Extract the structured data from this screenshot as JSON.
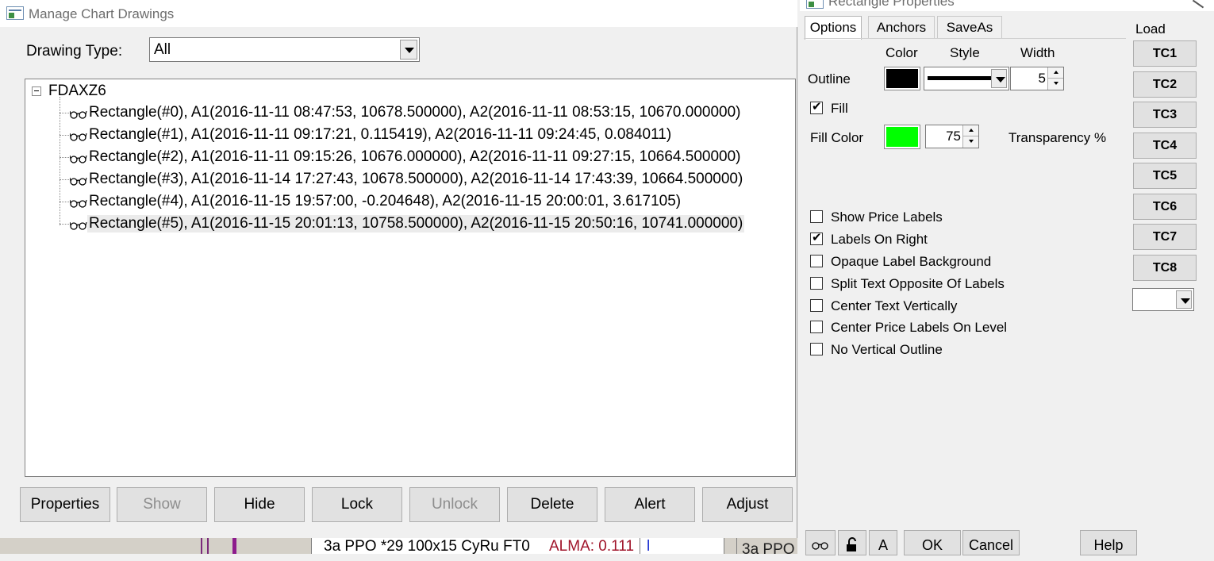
{
  "manage_window": {
    "title": "Manage Chart Drawings",
    "drawing_type_label": "Drawing Type:",
    "drawing_type_value": "All",
    "tree": {
      "root": "FDAXZ6",
      "items": [
        {
          "label": "Rectangle(#0), A1(2016-11-11  08:47:53, 10678.500000), A2(2016-11-11  08:53:15, 10670.000000)",
          "icon": "glasses-icon"
        },
        {
          "label": "Rectangle(#1), A1(2016-11-11  09:17:21, 0.115419), A2(2016-11-11  09:24:45, 0.084011)",
          "icon": "glasses-icon"
        },
        {
          "label": "Rectangle(#2), A1(2016-11-11  09:15:26, 10676.000000), A2(2016-11-11  09:27:15, 10664.500000)",
          "icon": "glasses-icon"
        },
        {
          "label": "Rectangle(#3), A1(2016-11-14  17:27:43, 10678.500000), A2(2016-11-14  17:43:39, 10664.500000)",
          "icon": "glasses-icon"
        },
        {
          "label": "Rectangle(#4), A1(2016-11-15  19:57:00, -0.204648), A2(2016-11-15  20:00:01, 3.617105)",
          "icon": "glasses-icon"
        },
        {
          "label": "Rectangle(#5), A1(2016-11-15  20:01:13, 10758.500000), A2(2016-11-15  20:50:16, 10741.000000)",
          "icon": "glasses-icon",
          "selected": true
        }
      ]
    },
    "buttons": {
      "properties": "Properties",
      "show": "Show",
      "hide": "Hide",
      "lock": "Lock",
      "unlock": "Unlock",
      "delete": "Delete",
      "alert": "Alert",
      "adjust": "Adjust"
    },
    "disabled_buttons": [
      "show",
      "unlock"
    ]
  },
  "taskbar": {
    "ppo_text": "3a PPO  *29 100x15 CyRu FT0",
    "alma_text": "ALMA: 0.111",
    "cursor_text": "l",
    "ppo2_text": "3a PPO"
  },
  "props_window": {
    "title": "Rectangle Properties",
    "tabs": [
      "Options",
      "Anchors",
      "SaveAs"
    ],
    "active_tab": "Options",
    "load_label": "Load",
    "headers": {
      "color": "Color",
      "style": "Style",
      "width": "Width"
    },
    "outline_label": "Outline",
    "outline_color": "#000000",
    "outline_width": "5",
    "fill_label": "Fill",
    "fill_checked": true,
    "fill_color_label": "Fill Color",
    "fill_color": "#00ff00",
    "transparency_value": "75",
    "transparency_label": "Transparency %",
    "options": [
      {
        "label": "Show Price Labels",
        "checked": false
      },
      {
        "label": "Labels On Right",
        "checked": true
      },
      {
        "label": "Opaque Label Background",
        "checked": false
      },
      {
        "label": "Split Text Opposite Of Labels",
        "checked": false
      },
      {
        "label": "Center Text Vertically",
        "checked": false
      },
      {
        "label": "Center Price Labels On Level",
        "checked": false
      },
      {
        "label": "No Vertical Outline",
        "checked": false
      }
    ],
    "template_buttons": [
      "TC1",
      "TC2",
      "TC3",
      "TC4",
      "TC5",
      "TC6",
      "TC7",
      "TC8"
    ],
    "bottom": {
      "text_button": "A",
      "ok": "OK",
      "cancel": "Cancel",
      "help": "Help"
    }
  }
}
